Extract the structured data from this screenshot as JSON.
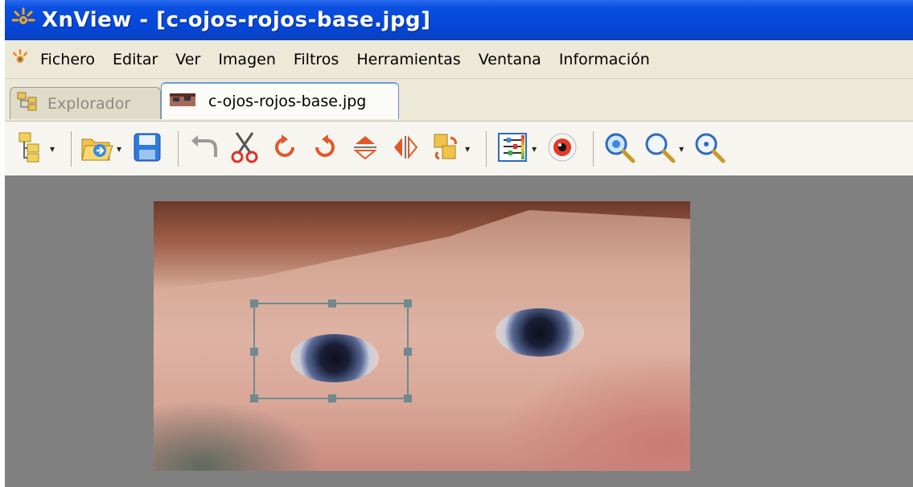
{
  "window": {
    "title": "XnView - [c-ojos-rojos-base.jpg]",
    "app_icon": "xnview-logo-icon"
  },
  "menu": {
    "items": [
      {
        "label": "Fichero"
      },
      {
        "label": "Editar"
      },
      {
        "label": "Ver"
      },
      {
        "label": "Imagen"
      },
      {
        "label": "Filtros"
      },
      {
        "label": "Herramientas"
      },
      {
        "label": "Ventana"
      },
      {
        "label": "Información"
      }
    ]
  },
  "tabs": [
    {
      "label": "Explorador",
      "active": false,
      "icon": "explorer-tree-icon"
    },
    {
      "label": "c-ojos-rojos-base.jpg",
      "active": true,
      "icon": "image-thumbnail-icon"
    }
  ],
  "toolbar": {
    "buttons": [
      "browse-icon",
      "open-folder-icon",
      "save-icon",
      "undo-icon",
      "cut-icon",
      "rotate-left-icon",
      "rotate-right-icon",
      "flip-vertical-icon",
      "flip-horizontal-icon",
      "transform-icon",
      "adjust-icon",
      "red-eye-icon",
      "zoom-in-icon",
      "zoom-out-icon",
      "zoom-fit-icon"
    ]
  },
  "colors": {
    "titlebar": "#0446d8",
    "menubar": "#ece9d8",
    "canvas_bg": "#808080",
    "selection": "#6f8a8f"
  }
}
